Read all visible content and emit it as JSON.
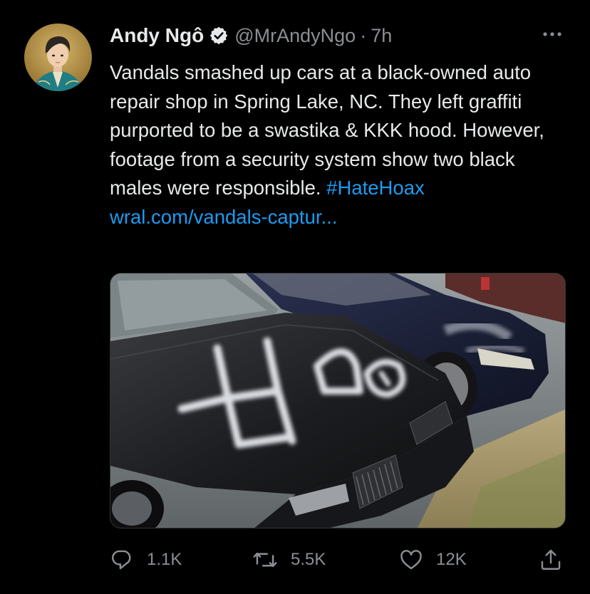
{
  "tweet": {
    "author": {
      "display_name": "Andy Ngô",
      "handle": "@MrAndyNgo",
      "separator": "·",
      "time": "7h",
      "verified": true,
      "avatar_icon": "user-avatar"
    },
    "text": {
      "body": "Vandals smashed up cars at a black-owned auto repair shop in Spring Lake, NC. They left graffiti purported to be a swastika & KKK hood. However, footage from a security system show two black males were responsible. ",
      "hashtag": "#HateHoax",
      "space": " ",
      "link": "wral.com/vandals-captur..."
    },
    "media": {
      "type": "photo",
      "spray_text": "卐 KKK"
    },
    "actions": {
      "reply_count": "1.1K",
      "retweet_count": "5.5K",
      "like_count": "12K"
    }
  },
  "colors": {
    "background": "#000000",
    "text_primary": "#e7e9ea",
    "text_secondary": "#8b8f94",
    "link": "#1d9bf0"
  },
  "icons": {
    "verified": "verified-badge-icon",
    "more": "more-options-icon",
    "reply": "reply-icon",
    "retweet": "retweet-icon",
    "like": "like-icon",
    "share": "share-icon"
  }
}
